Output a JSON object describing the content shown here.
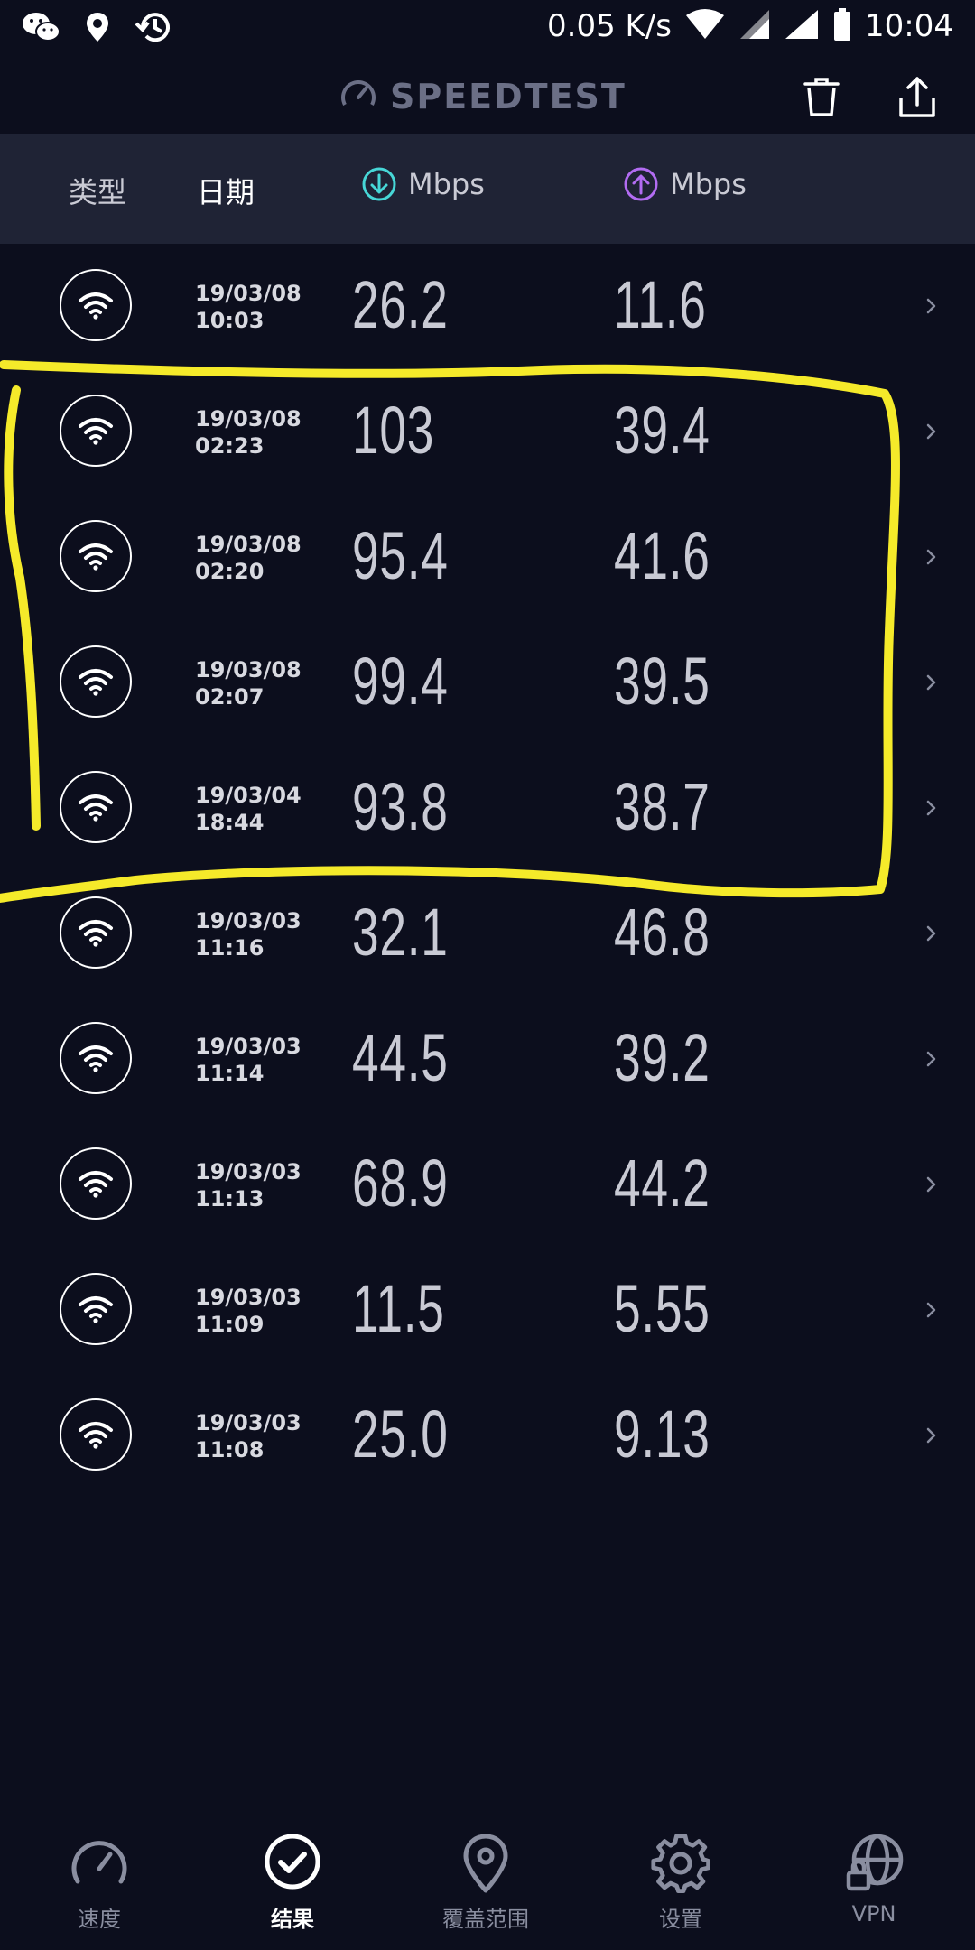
{
  "status_bar": {
    "speed": "0.05 K/s",
    "time": "10:04"
  },
  "header": {
    "title": "SPEEDTEST"
  },
  "columns": {
    "type": "类型",
    "date": "日期",
    "download": "Mbps",
    "upload": "Mbps"
  },
  "colors": {
    "background": "#0c0e1d",
    "download_accent": "#47d7d7",
    "upload_accent": "#b26cf2",
    "highlight": "#f5ea2a"
  },
  "results": [
    {
      "date": "19/03/08",
      "time": "10:03",
      "download": "26.2",
      "upload": "11.6"
    },
    {
      "date": "19/03/08",
      "time": "02:23",
      "download": "103",
      "upload": "39.4"
    },
    {
      "date": "19/03/08",
      "time": "02:20",
      "download": "95.4",
      "upload": "41.6"
    },
    {
      "date": "19/03/08",
      "time": "02:07",
      "download": "99.4",
      "upload": "39.5"
    },
    {
      "date": "19/03/04",
      "time": "18:44",
      "download": "93.8",
      "upload": "38.7"
    },
    {
      "date": "19/03/03",
      "time": "11:16",
      "download": "32.1",
      "upload": "46.8"
    },
    {
      "date": "19/03/03",
      "time": "11:14",
      "download": "44.5",
      "upload": "39.2"
    },
    {
      "date": "19/03/03",
      "time": "11:13",
      "download": "68.9",
      "upload": "44.2"
    },
    {
      "date": "19/03/03",
      "time": "11:09",
      "download": "11.5",
      "upload": "5.55"
    },
    {
      "date": "19/03/03",
      "time": "11:08",
      "download": "25.0",
      "upload": "9.13"
    }
  ],
  "nav": [
    {
      "label": "速度",
      "icon": "speedometer-icon"
    },
    {
      "label": "结果",
      "icon": "check-circle-icon"
    },
    {
      "label": "覆盖范围",
      "icon": "map-pin-icon"
    },
    {
      "label": "设置",
      "icon": "gear-icon"
    },
    {
      "label": "VPN",
      "icon": "vpn-globe-lock-icon"
    }
  ]
}
